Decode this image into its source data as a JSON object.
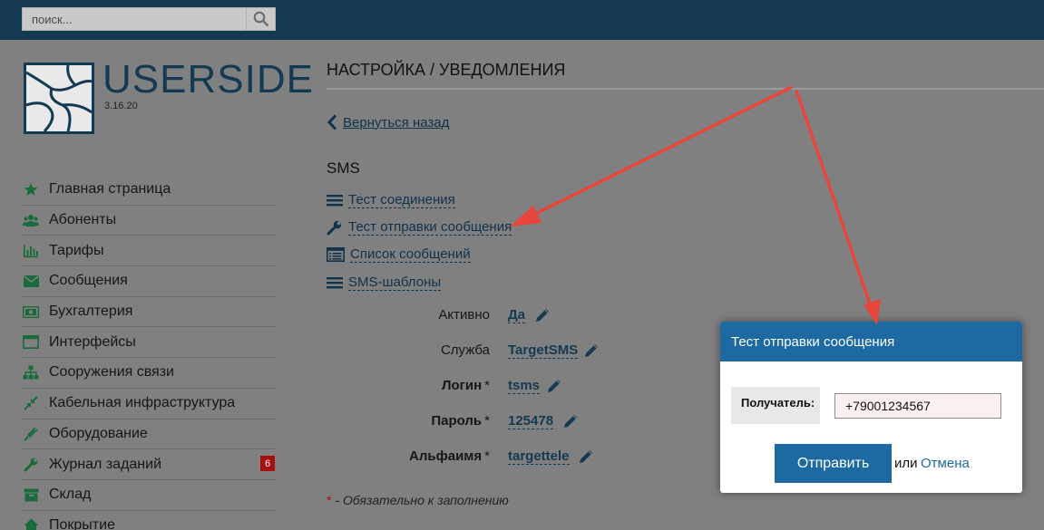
{
  "header": {
    "search_placeholder": "поиск..."
  },
  "logo": {
    "title": "USERSIDE",
    "version": "3.16.20"
  },
  "sidebar": {
    "items": [
      {
        "label": "Главная страница",
        "icon": "star-icon"
      },
      {
        "label": "Абоненты",
        "icon": "users-icon"
      },
      {
        "label": "Тарифы",
        "icon": "bar-chart-icon"
      },
      {
        "label": "Сообщения",
        "icon": "envelope-icon"
      },
      {
        "label": "Бухгалтерия",
        "icon": "money-icon"
      },
      {
        "label": "Интерфейсы",
        "icon": "window-icon"
      },
      {
        "label": "Сооружения связи",
        "icon": "sitemap-icon"
      },
      {
        "label": "Кабельная инфраструктура",
        "icon": "compress-icon"
      },
      {
        "label": "Оборудование",
        "icon": "plug-icon"
      },
      {
        "label": "Журнал заданий",
        "icon": "wrench-icon",
        "badge": "6"
      },
      {
        "label": "Склад",
        "icon": "archive-icon"
      },
      {
        "label": "Покрытие",
        "icon": "home-icon"
      }
    ]
  },
  "main": {
    "title": "НАСТРОЙКА / УВЕДОМЛЕНИЯ",
    "back_label": "Вернуться назад",
    "section_title": "SMS",
    "actions": [
      {
        "label": "Тест соединения",
        "icon": "bars-icon"
      },
      {
        "label": "Тест отправки сообщения",
        "icon": "wrench-icon"
      },
      {
        "label": "Список сообщений",
        "icon": "list-alt-icon"
      },
      {
        "label": "SMS-шаблоны",
        "icon": "bars-icon"
      }
    ],
    "fields": [
      {
        "label": "Активно",
        "value": "Да",
        "required": false
      },
      {
        "label": "Служба",
        "value": "TargetSMS",
        "required": false
      },
      {
        "label": "Логин",
        "value": "tsms",
        "required": true
      },
      {
        "label": "Пароль",
        "value": "125478",
        "required": true
      },
      {
        "label": "Альфаимя",
        "value": "targettele",
        "required": true
      }
    ],
    "required_star": "*",
    "required_note": "- Обязательно к заполнению"
  },
  "modal": {
    "title": "Тест отправки сообщения",
    "recipient_label": "Получатель:",
    "recipient_value": "+79001234567",
    "send_label": "Отправить",
    "or_label": "или",
    "cancel_label": "Отмена"
  },
  "colors": {
    "header_bg": "#133a52",
    "accent": "#1d6aa2",
    "badge": "#a81010",
    "annotation_arrow": "#e8453c"
  }
}
